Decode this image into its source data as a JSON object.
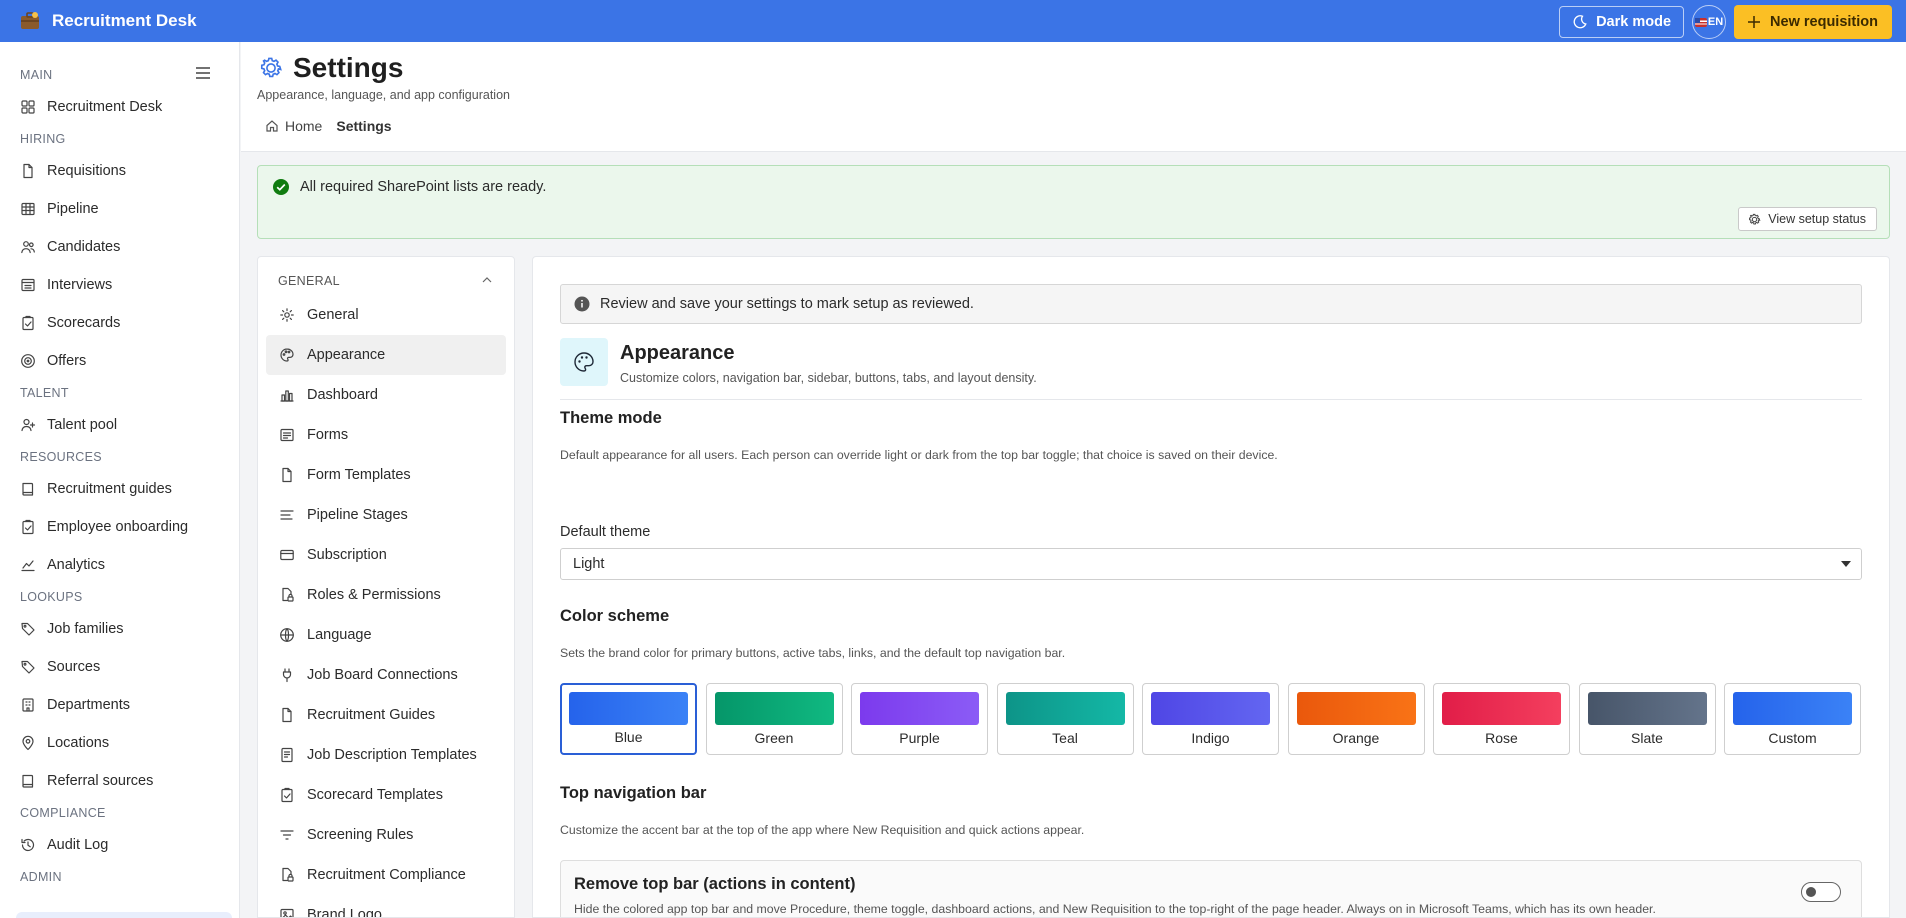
{
  "app": {
    "title": "Recruitment Desk"
  },
  "topbar": {
    "dark_mode_label": "Dark mode",
    "language_code": "EN",
    "new_requisition_label": "New requisition"
  },
  "sidebar": {
    "sections": [
      {
        "label": "MAIN",
        "items": [
          {
            "label": "Recruitment Desk",
            "icon": "grid-icon"
          }
        ]
      },
      {
        "label": "HIRING",
        "items": [
          {
            "label": "Requisitions",
            "icon": "document-icon"
          },
          {
            "label": "Pipeline",
            "icon": "table-icon"
          },
          {
            "label": "Candidates",
            "icon": "people-icon"
          },
          {
            "label": "Interviews",
            "icon": "calendar-list-icon"
          },
          {
            "label": "Scorecards",
            "icon": "clipboard-check-icon"
          },
          {
            "label": "Offers",
            "icon": "target-icon"
          }
        ]
      },
      {
        "label": "TALENT",
        "items": [
          {
            "label": "Talent pool",
            "icon": "person-add-icon"
          }
        ]
      },
      {
        "label": "RESOURCES",
        "items": [
          {
            "label": "Recruitment guides",
            "icon": "book-icon"
          },
          {
            "label": "Employee onboarding",
            "icon": "clipboard-check-icon"
          },
          {
            "label": "Analytics",
            "icon": "analytics-icon"
          }
        ]
      },
      {
        "label": "LOOKUPS",
        "items": [
          {
            "label": "Job families",
            "icon": "tag-icon"
          },
          {
            "label": "Sources",
            "icon": "tag-icon"
          },
          {
            "label": "Departments",
            "icon": "building-icon"
          },
          {
            "label": "Locations",
            "icon": "location-icon"
          },
          {
            "label": "Referral sources",
            "icon": "book-icon"
          }
        ]
      },
      {
        "label": "COMPLIANCE",
        "items": [
          {
            "label": "Audit Log",
            "icon": "history-icon"
          }
        ]
      },
      {
        "label": "ADMIN",
        "items": []
      }
    ]
  },
  "header": {
    "title": "Settings",
    "subtitle": "Appearance, language, and app configuration",
    "breadcrumb": {
      "home": "Home",
      "current": "Settings"
    }
  },
  "banner": {
    "message": "All required SharePoint lists are ready.",
    "button_label": "View setup status"
  },
  "settings_nav": {
    "group_label": "GENERAL",
    "active": "Appearance",
    "items": [
      {
        "label": "General",
        "icon": "gear-icon"
      },
      {
        "label": "Appearance",
        "icon": "palette-icon"
      },
      {
        "label": "Dashboard",
        "icon": "bar-chart-icon"
      },
      {
        "label": "Forms",
        "icon": "form-icon"
      },
      {
        "label": "Form Templates",
        "icon": "document-icon"
      },
      {
        "label": "Pipeline Stages",
        "icon": "lines-icon"
      },
      {
        "label": "Subscription",
        "icon": "card-icon"
      },
      {
        "label": "Roles & Permissions",
        "icon": "lock-doc-icon"
      },
      {
        "label": "Language",
        "icon": "globe-icon"
      },
      {
        "label": "Job Board Connections",
        "icon": "plug-icon"
      },
      {
        "label": "Recruitment Guides",
        "icon": "document-icon"
      },
      {
        "label": "Job Description Templates",
        "icon": "doc-text-icon"
      },
      {
        "label": "Scorecard Templates",
        "icon": "clipboard-check-icon"
      },
      {
        "label": "Screening Rules",
        "icon": "filter-icon"
      },
      {
        "label": "Recruitment Compliance",
        "icon": "lock-doc-icon"
      },
      {
        "label": "Brand Logo",
        "icon": "image-icon"
      }
    ]
  },
  "content": {
    "info": "Review and save your settings to mark setup as reviewed.",
    "section": {
      "title": "Appearance",
      "subtitle": "Customize colors, navigation bar, sidebar, buttons, tabs, and layout density."
    },
    "theme_mode": {
      "title": "Theme mode",
      "description": "Default appearance for all users. Each person can override light or dark from the top bar toggle; that choice is saved on their device.",
      "field_label": "Default theme",
      "value": "Light"
    },
    "color_scheme": {
      "title": "Color scheme",
      "description": "Sets the brand color for primary buttons, active tabs, links, and the default top navigation bar.",
      "selected": "Blue",
      "options": [
        {
          "label": "Blue",
          "from": "#2563eb",
          "to": "#3b82f6"
        },
        {
          "label": "Green",
          "from": "#059669",
          "to": "#10b981"
        },
        {
          "label": "Purple",
          "from": "#7c3aed",
          "to": "#8b5cf6"
        },
        {
          "label": "Teal",
          "from": "#0d9488",
          "to": "#14b8a6"
        },
        {
          "label": "Indigo",
          "from": "#4f46e5",
          "to": "#6366f1"
        },
        {
          "label": "Orange",
          "from": "#ea580c",
          "to": "#f97316"
        },
        {
          "label": "Rose",
          "from": "#e11d48",
          "to": "#f43f5e"
        },
        {
          "label": "Slate",
          "from": "#475569",
          "to": "#64748b"
        },
        {
          "label": "Custom",
          "from": "#2563eb",
          "to": "#3b82f6"
        }
      ]
    },
    "top_nav": {
      "title": "Top navigation bar",
      "description": "Customize the accent bar at the top of the app where New Requisition and quick actions appear.",
      "toggle_title": "Remove top bar (actions in content)",
      "toggle_description": "Hide the colored app top bar and move Procedure, theme toggle, dashboard actions, and New Requisition to the top-right of the page header. Always on in Microsoft Teams, which has its own header.",
      "toggle_on": false
    }
  },
  "colors": {
    "topbar": "#3b74e6",
    "accent": "#fbbf24",
    "success": "#107c10"
  }
}
